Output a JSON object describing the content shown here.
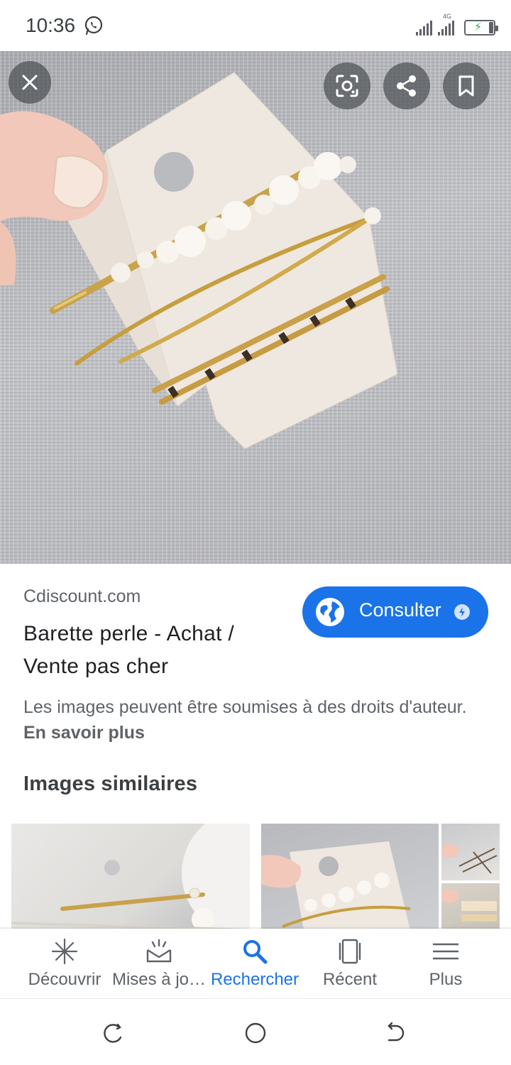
{
  "status_bar": {
    "time": "10:36",
    "network_label": "4G"
  },
  "hero": {
    "close_icon": "close-icon",
    "lens_icon": "google-lens-icon",
    "share_icon": "share-icon",
    "save_icon": "bookmark-icon"
  },
  "result": {
    "source": "Cdiscount.com",
    "title": "Barette perle - Achat / Vente pas cher",
    "consult_label": "Consulter",
    "copyright_text": "Les images peuvent être soumises à des droits d'auteur.",
    "learn_more": "En savoir plus"
  },
  "similar": {
    "heading": "Images similaires"
  },
  "bottom_nav": {
    "items": [
      {
        "label": "Découvrir",
        "icon": "asterisk-icon"
      },
      {
        "label": "Mises à jo…",
        "icon": "updates-tray-icon"
      },
      {
        "label": "Rechercher",
        "icon": "search-icon"
      },
      {
        "label": "Récent",
        "icon": "recent-tabs-icon"
      },
      {
        "label": "Plus",
        "icon": "menu-icon"
      }
    ],
    "active_index": 2
  },
  "colors": {
    "accent": "#1a73e8",
    "text_primary": "#202124",
    "text_secondary": "#5f6368"
  }
}
